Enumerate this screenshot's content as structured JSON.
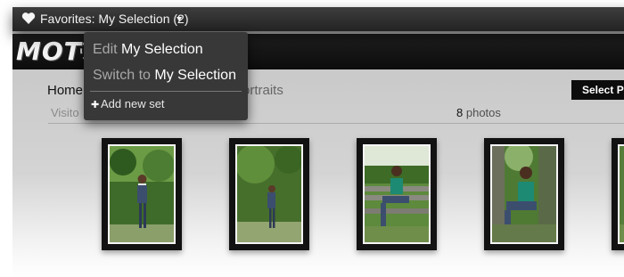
{
  "favorites_bar": {
    "label": "Favorites: My Selection (2)",
    "icon": "heart-icon"
  },
  "dropdown": {
    "edit_prefix": "Edit",
    "edit_target": "My Selection",
    "switch_prefix": "Switch to",
    "switch_target": "My Selection",
    "add_label": "Add new set"
  },
  "site": {
    "logo_text": "MOT"
  },
  "nav": {
    "home": "Home",
    "portraits": "ortraits",
    "select_button": "Select Ph"
  },
  "gallery": {
    "visitor_label": "Visito",
    "photo_count": "8",
    "photo_count_label": "photos",
    "photos": [
      {
        "subject": "standing-in-field"
      },
      {
        "subject": "standing-in-field-far"
      },
      {
        "subject": "sitting-on-bench"
      },
      {
        "subject": "sitting-on-rock"
      },
      {
        "subject": "portrait-partial"
      }
    ]
  },
  "colors": {
    "bar": "#2e2e2e",
    "dropdown": "#383838",
    "page": "#c9c9c9",
    "button": "#0c0c0c"
  }
}
